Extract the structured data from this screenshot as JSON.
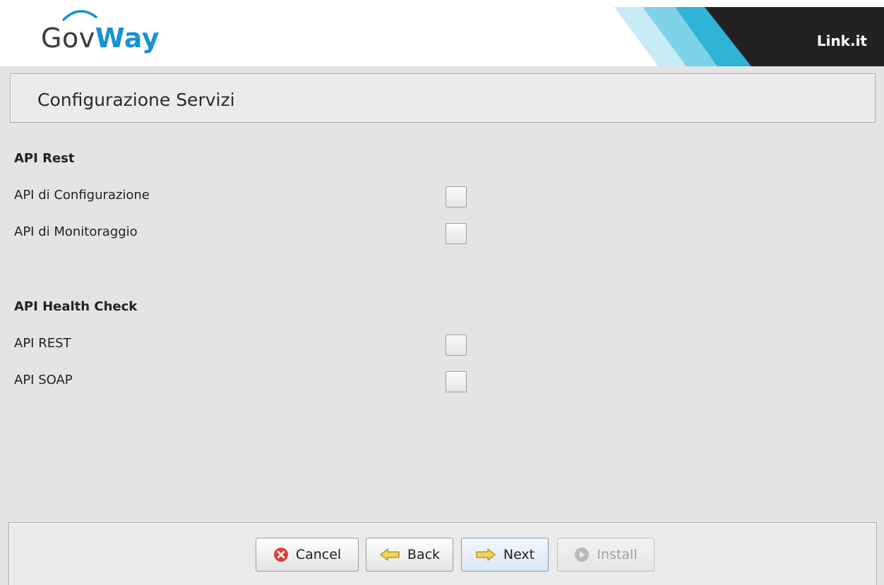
{
  "header": {
    "logo_part1": "Gov",
    "logo_part2": "Way",
    "brand": "Link.it"
  },
  "page_title": "Configurazione Servizi",
  "sections": [
    {
      "heading": "API Rest",
      "items": [
        {
          "label": "API di Configurazione",
          "checked": false
        },
        {
          "label": "API di Monitoraggio",
          "checked": false
        }
      ]
    },
    {
      "heading": "API Health Check",
      "items": [
        {
          "label": "API REST",
          "checked": false
        },
        {
          "label": "API SOAP",
          "checked": false
        }
      ]
    }
  ],
  "buttons": {
    "cancel": "Cancel",
    "back": "Back",
    "next": "Next",
    "install": "Install"
  },
  "icons": {
    "cancel": "cancel-x-icon",
    "back": "arrow-left-icon",
    "next": "arrow-right-icon",
    "install": "install-disc-icon"
  },
  "colors": {
    "logo_blue": "#1693d0",
    "brand_dark": "#222222",
    "stripe_light": "#bfe8f3",
    "stripe_mid": "#3fb9d8",
    "cancel_red": "#d9433c",
    "arrow_yellow": "#f2d35b"
  }
}
